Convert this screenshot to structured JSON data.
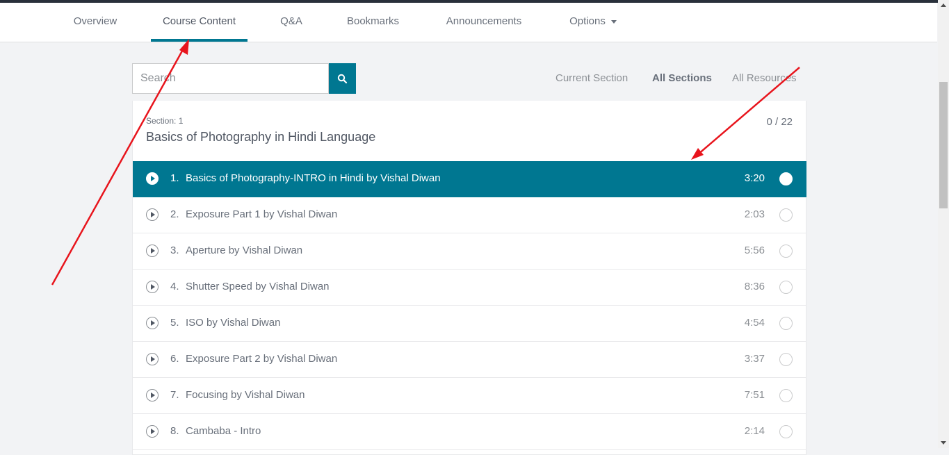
{
  "tabs": [
    {
      "label": "Overview",
      "active": false
    },
    {
      "label": "Course Content",
      "active": true
    },
    {
      "label": "Q&A",
      "active": false
    },
    {
      "label": "Bookmarks",
      "active": false
    },
    {
      "label": "Announcements",
      "active": false
    },
    {
      "label": "Options",
      "active": false,
      "has_dropdown": true
    }
  ],
  "search": {
    "placeholder": "Search",
    "value": "",
    "icon": "search-icon"
  },
  "filters": [
    {
      "label": "Current Section",
      "active": false
    },
    {
      "label": "All Sections",
      "active": true
    },
    {
      "label": "All Resources",
      "active": false
    }
  ],
  "section": {
    "kicker": "Section: 1",
    "title": "Basics of Photography in Hindi Language",
    "progress": "0 / 22"
  },
  "lectures": [
    {
      "num": "1.",
      "title": "Basics of Photography-INTRO in Hindi by Vishal Diwan",
      "duration": "3:20",
      "current": true,
      "completed": false
    },
    {
      "num": "2.",
      "title": "Exposure Part 1 by Vishal Diwan",
      "duration": "2:03",
      "current": false,
      "completed": false
    },
    {
      "num": "3.",
      "title": "Aperture by Vishal Diwan",
      "duration": "5:56",
      "current": false,
      "completed": false
    },
    {
      "num": "4.",
      "title": "Shutter Speed by Vishal Diwan",
      "duration": "8:36",
      "current": false,
      "completed": false
    },
    {
      "num": "5.",
      "title": "ISO by Vishal Diwan",
      "duration": "4:54",
      "current": false,
      "completed": false
    },
    {
      "num": "6.",
      "title": "Exposure Part 2 by Vishal Diwan",
      "duration": "3:37",
      "current": false,
      "completed": false
    },
    {
      "num": "7.",
      "title": "Focusing by Vishal Diwan",
      "duration": "7:51",
      "current": false,
      "completed": false
    },
    {
      "num": "8.",
      "title": "Cambaba - Intro",
      "duration": "2:14",
      "current": false,
      "completed": false
    }
  ],
  "colors": {
    "accent": "#007791",
    "annotation_arrow": "#e8141c"
  }
}
